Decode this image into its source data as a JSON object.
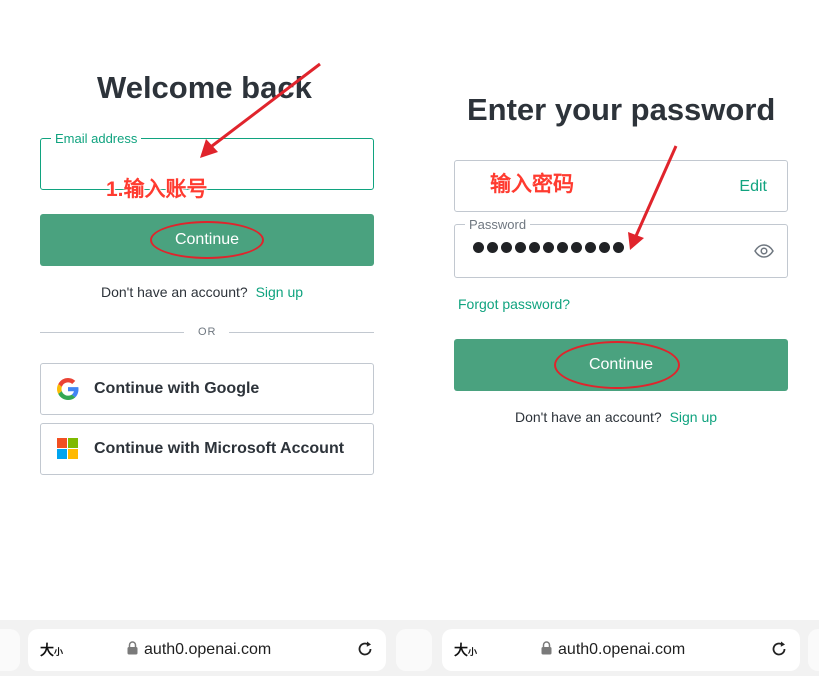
{
  "left": {
    "title": "Welcome back",
    "email_label": "Email address",
    "email_value": "",
    "continue_label": "Continue",
    "no_account_text": "Don't have an account?",
    "signup_link": "Sign up",
    "or_text": "OR",
    "google_label": "Continue with Google",
    "microsoft_label": "Continue with Microsoft Account",
    "annotation": "1.输入账号"
  },
  "right": {
    "title": "Enter your password",
    "edit_label": "Edit",
    "password_label": "Password",
    "password_dot_count": 11,
    "forgot_link": "Forgot password?",
    "continue_label": "Continue",
    "no_account_text": "Don't have an account?",
    "signup_link": "Sign up",
    "annotation": "输入密码"
  },
  "browser_bar": {
    "text_size_label": "大",
    "text_size_small": "小",
    "url": "auth0.openai.com"
  },
  "colors": {
    "accent": "#10a37f",
    "button": "#4aa27f",
    "annotation": "#ff3b30",
    "microsoft": [
      "#f25022",
      "#7fba00",
      "#00a4ef",
      "#ffb900"
    ]
  },
  "icons": {
    "google": "google-logo-icon",
    "microsoft": "microsoft-logo-icon",
    "eye": "eye-icon",
    "lock": "lock-icon",
    "reload": "reload-icon"
  }
}
